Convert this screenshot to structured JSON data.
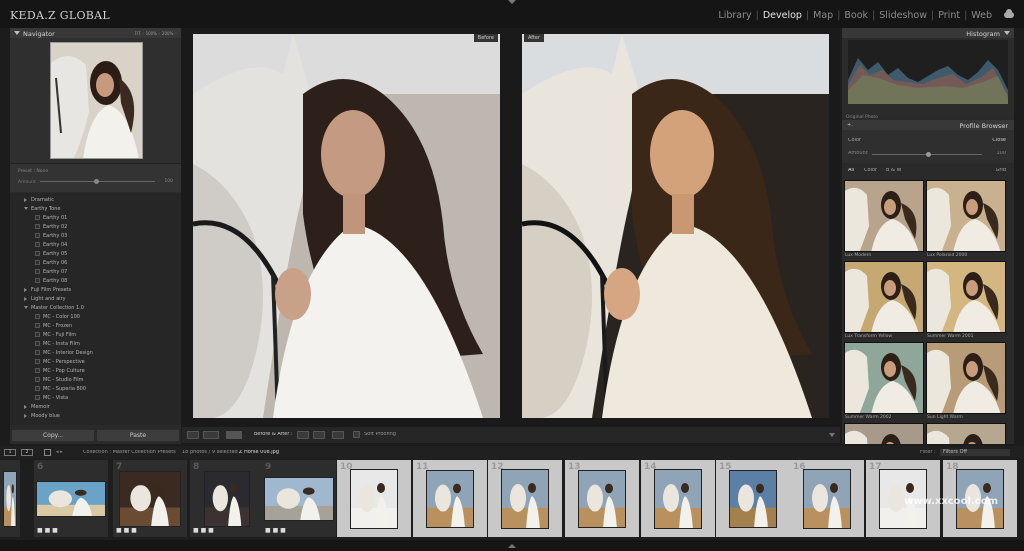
{
  "app": {
    "brand": "KEDA.Z GLOBAL"
  },
  "modules": {
    "items": [
      "Library",
      "Develop",
      "Map",
      "Book",
      "Slideshow",
      "Print",
      "Web"
    ],
    "active": "Develop"
  },
  "navigator": {
    "title": "Navigator",
    "zoom": "FIT  ◦  100%  ◦  200%  ◦"
  },
  "preset_amount": {
    "label": "Preset : None",
    "amount_label": "Amount",
    "value": "100"
  },
  "presets": [
    {
      "name": "Dramatic",
      "level": 0,
      "type": "folder",
      "open": false
    },
    {
      "name": "Earthy Tone",
      "level": 0,
      "type": "folder",
      "open": true
    },
    {
      "name": "Earthy 01",
      "level": 1,
      "type": "preset"
    },
    {
      "name": "Earthy 02",
      "level": 1,
      "type": "preset"
    },
    {
      "name": "Earthy 03",
      "level": 1,
      "type": "preset"
    },
    {
      "name": "Earthy 04",
      "level": 1,
      "type": "preset"
    },
    {
      "name": "Earthy 05",
      "level": 1,
      "type": "preset"
    },
    {
      "name": "Earthy 06",
      "level": 1,
      "type": "preset"
    },
    {
      "name": "Earthy 07",
      "level": 1,
      "type": "preset"
    },
    {
      "name": "Earthy 08",
      "level": 1,
      "type": "preset"
    },
    {
      "name": "Fuji Film Presets",
      "level": 0,
      "type": "folder",
      "open": false
    },
    {
      "name": "Light and airy",
      "level": 0,
      "type": "folder",
      "open": false
    },
    {
      "name": "Master Collection 1.0",
      "level": 0,
      "type": "folder",
      "open": true
    },
    {
      "name": "MC - Color 100",
      "level": 1,
      "type": "preset"
    },
    {
      "name": "MC - Frozen",
      "level": 1,
      "type": "preset"
    },
    {
      "name": "MC - Fuji Film",
      "level": 1,
      "type": "preset"
    },
    {
      "name": "MC - Insta Film",
      "level": 1,
      "type": "preset"
    },
    {
      "name": "MC - Interior Design",
      "level": 1,
      "type": "preset"
    },
    {
      "name": "MC - Perspective",
      "level": 1,
      "type": "preset"
    },
    {
      "name": "MC - Pop Culture",
      "level": 1,
      "type": "preset"
    },
    {
      "name": "MC - Studio Film",
      "level": 1,
      "type": "preset"
    },
    {
      "name": "MC - Superia 800",
      "level": 1,
      "type": "preset"
    },
    {
      "name": "MC - Vista",
      "level": 1,
      "type": "preset"
    },
    {
      "name": "Memoir",
      "level": 0,
      "type": "folder",
      "open": false
    },
    {
      "name": "Moody blue",
      "level": 0,
      "type": "folder",
      "open": false
    }
  ],
  "left_buttons": {
    "copy": "Copy...",
    "paste": "Paste"
  },
  "center": {
    "before_label": "Before",
    "after_label": "After"
  },
  "toolbar": {
    "before_after_label": "Before & After :",
    "soft_proof_label": "Soft Proofing"
  },
  "histogram": {
    "title": "Histogram",
    "original_photo_label": "Original Photo"
  },
  "profile_browser": {
    "title": "Profile Browser",
    "color_label": "Color",
    "close_label": "Close",
    "amount_label": "Amount",
    "amount_value": "100",
    "tabs": [
      "All",
      "Color",
      "B & W"
    ],
    "view_label": "Grid",
    "profiles": [
      "Lux Modern",
      "Lux Polaroid 2000",
      "Lux Transform Yellow",
      "Summer Warm 2001",
      "Summer Warm 2002",
      "Sun Light Warm",
      "",
      ""
    ]
  },
  "filmstrip_bar": {
    "pages": [
      "1",
      "2"
    ],
    "path": "Collection : Master Collection Presets",
    "count": "18 photos / 9 selected /",
    "file": "Z Horse 008.jpg",
    "filter_label": "Filter :",
    "filter_value": "Filters Off"
  },
  "filmstrip": {
    "numbers": [
      "",
      "6",
      "7",
      "8",
      "9",
      "10",
      "11",
      "12",
      "13",
      "14",
      "15",
      "16",
      "17",
      "18"
    ],
    "dots": "■ ■ ■"
  },
  "watermark": "www.xxcool.com"
}
